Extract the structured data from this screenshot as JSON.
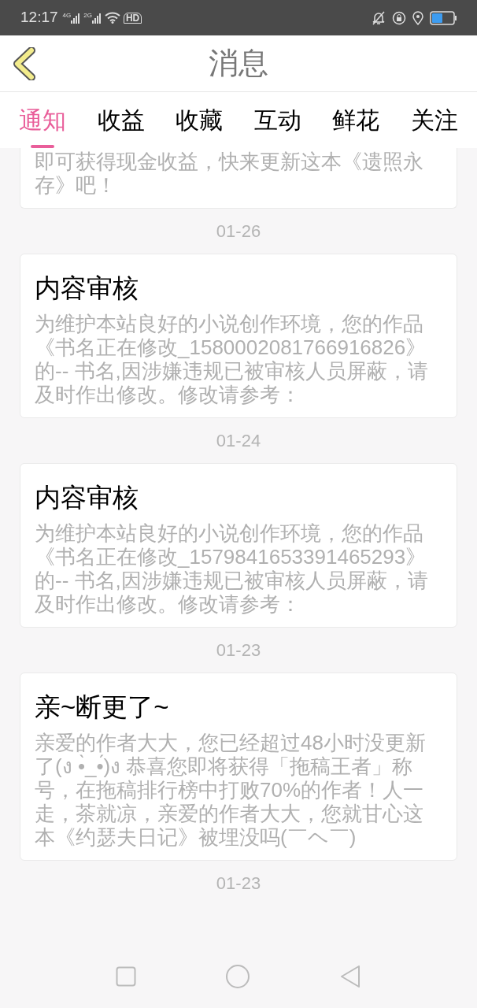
{
  "status_bar": {
    "time": "12:17",
    "network_1": "4G",
    "network_2": "2G",
    "hd": "HD"
  },
  "header": {
    "title": "消息"
  },
  "tabs": [
    {
      "label": "通知",
      "selected": true
    },
    {
      "label": "收益",
      "selected": false
    },
    {
      "label": "收藏",
      "selected": false
    },
    {
      "label": "互动",
      "selected": false
    },
    {
      "label": "鲜花",
      "selected": false
    },
    {
      "label": "关注",
      "selected": false
    }
  ],
  "messages": [
    {
      "body": "即可获得现金收益，快来更新这本《遗照永存》吧！"
    },
    {
      "date": "01-26",
      "title": "内容审核",
      "body": "为维护本站良好的小说创作环境，您的作品《书名正在修改_1580002081766916826》的-- 书名,因涉嫌违规已被审核人员屏蔽，请及时作出修改。修改请参考："
    },
    {
      "date": "01-24",
      "title": "内容审核",
      "body": "为维护本站良好的小说创作环境，您的作品《书名正在修改_1579841653391465293》的-- 书名,因涉嫌违规已被审核人员屏蔽，请及时作出修改。修改请参考："
    },
    {
      "date": "01-23",
      "title": "亲~断更了~",
      "body": "亲爱的作者大大，您已经超过48小时没更新了(ง •̀_•́)ง 恭喜您即将获得「拖稿王者」称号，在拖稿排行榜中打败70%的作者！人一走，茶就凉，亲爱的作者大大，您就甘心这本《约瑟夫日记》被埋没吗(￣ヘ￣)"
    },
    {
      "date": "01-23"
    }
  ]
}
